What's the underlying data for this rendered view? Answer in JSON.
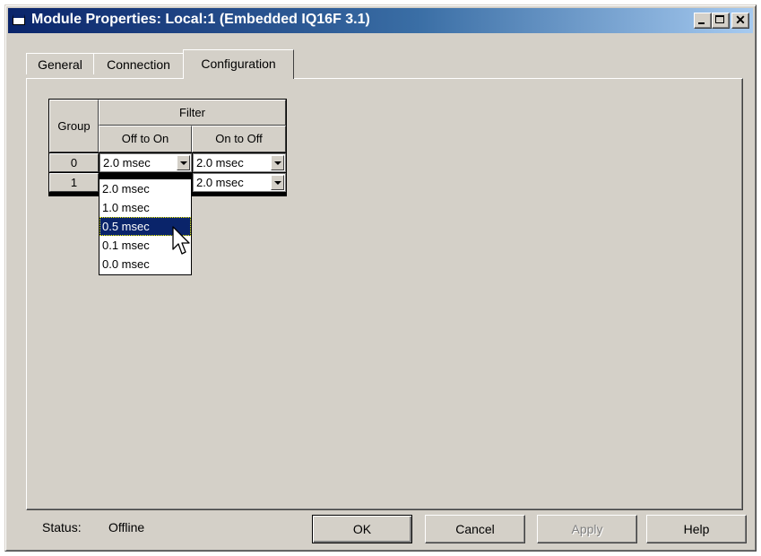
{
  "window": {
    "title": "Module Properties: Local:1 (Embedded IQ16F 3.1)"
  },
  "tabs": [
    {
      "label": "General",
      "active": false
    },
    {
      "label": "Connection",
      "active": false
    },
    {
      "label": "Configuration",
      "active": true
    }
  ],
  "grid": {
    "group_header": "Group",
    "filter_header": "Filter",
    "col_off_to_on": "Off to On",
    "col_on_to_off": "On to Off",
    "rows": [
      {
        "group": "0",
        "off_to_on": "2.0 msec",
        "on_to_off": "2.0 msec"
      },
      {
        "group": "1",
        "off_to_on": "",
        "on_to_off": "2.0 msec"
      }
    ]
  },
  "dropdown": {
    "options": [
      "2.0 msec",
      "1.0 msec",
      "0.5 msec",
      "0.1 msec",
      "0.0 msec"
    ],
    "selected": "0.5 msec"
  },
  "status": {
    "label": "Status:",
    "value": "Offline"
  },
  "buttons": {
    "ok": "OK",
    "cancel": "Cancel",
    "apply": "Apply",
    "help": "Help"
  },
  "colors": {
    "title_bar": "#0a246a",
    "face": "#d4d0c8",
    "highlight": "#0a246a"
  }
}
